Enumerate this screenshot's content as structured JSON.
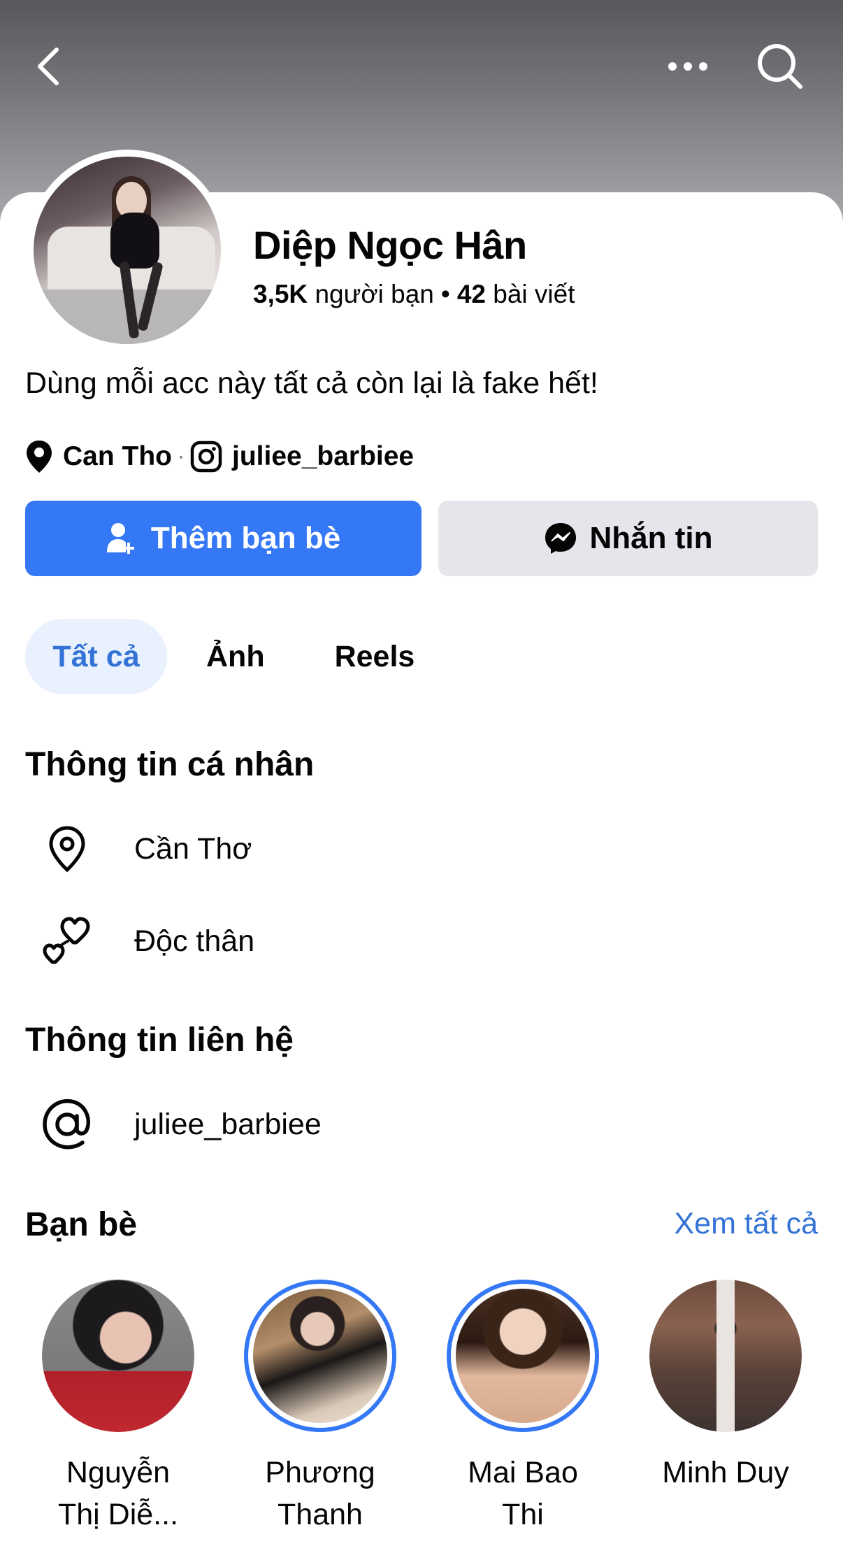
{
  "profile": {
    "name": "Diệp Ngọc Hân",
    "friends_count": "3,5K",
    "friends_label": "người bạn",
    "posts_count": "42",
    "posts_label": "bài viết",
    "bio": "Dùng mỗi acc này tất cả còn lại là fake hết!",
    "location_short": "Can Tho",
    "instagram": "juliee_barbiee"
  },
  "actions": {
    "add_friend": "Thêm bạn bè",
    "message": "Nhắn tin"
  },
  "tabs": [
    {
      "label": "Tất cả",
      "active": true
    },
    {
      "label": "Ảnh",
      "active": false
    },
    {
      "label": "Reels",
      "active": false
    }
  ],
  "personal_info": {
    "title": "Thông tin cá nhân",
    "items": [
      {
        "icon": "location-pin-icon",
        "text": "Cần Thơ"
      },
      {
        "icon": "hearts-icon",
        "text": "Độc thân"
      }
    ]
  },
  "contact_info": {
    "title": "Thông tin liên hệ",
    "items": [
      {
        "icon": "at-sign-icon",
        "text": "juliee_barbiee"
      }
    ]
  },
  "friends": {
    "title": "Bạn bè",
    "see_all": "Xem tất cả",
    "items": [
      {
        "name_line1": "Nguyễn",
        "name_line2": "Thị Diễ...",
        "has_story": false
      },
      {
        "name_line1": "Phương",
        "name_line2": "Thanh",
        "has_story": true
      },
      {
        "name_line1": "Mai Bao",
        "name_line2": "Thi",
        "has_story": true
      },
      {
        "name_line1": "Minh Duy",
        "name_line2": "",
        "has_story": false
      }
    ]
  },
  "colors": {
    "accent": "#3578f5",
    "link": "#3373d6",
    "secondary_button": "#e4e6eb",
    "active_tab_bg": "#e8f1fd"
  }
}
